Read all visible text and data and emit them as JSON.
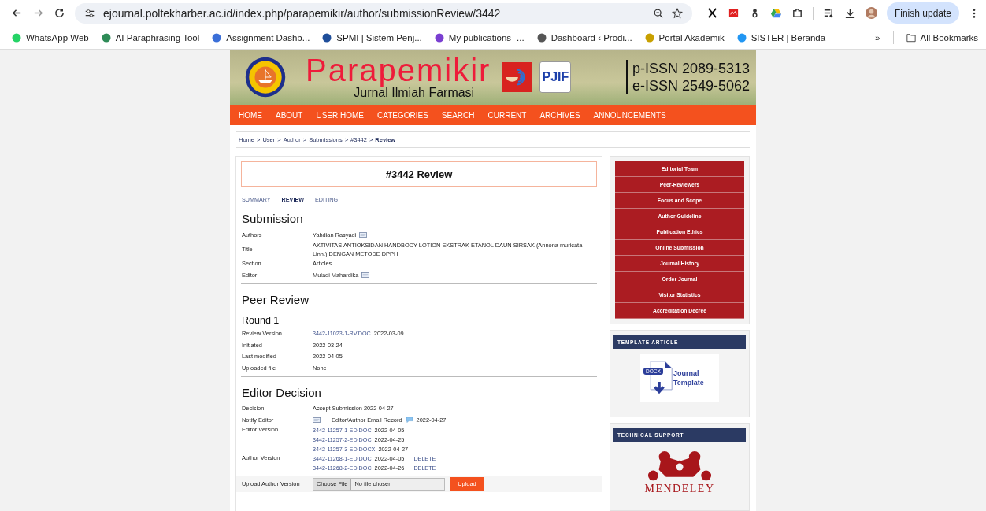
{
  "browser": {
    "address": "ejournal.poltekharber.ac.id/index.php/parapemikir/author/submissionReview/3442",
    "update_button": "Finish update",
    "bookmarks": [
      {
        "label": "WhatsApp Web"
      },
      {
        "label": "AI Paraphrasing Tool"
      },
      {
        "label": "Assignment Dashb..."
      },
      {
        "label": "SPMI | Sistem Penj..."
      },
      {
        "label": "My publications -..."
      },
      {
        "label": "Dashboard ‹ Prodi..."
      },
      {
        "label": "Portal Akademik"
      },
      {
        "label": "SISTER | Beranda"
      }
    ],
    "more": "»",
    "all_bookmarks": "All Bookmarks"
  },
  "header": {
    "title": "Parapemikir",
    "subtitle": "Jurnal Ilmiah Farmasi",
    "badge": "PJIF",
    "issn": [
      "p-ISSN 2089-5313",
      "e-ISSN 2549-5062"
    ]
  },
  "nav": [
    "HOME",
    "ABOUT",
    "USER HOME",
    "CATEGORIES",
    "SEARCH",
    "CURRENT",
    "ARCHIVES",
    "ANNOUNCEMENTS"
  ],
  "breadcrumb": {
    "links": [
      "Home",
      "User",
      "Author",
      "Submissions",
      "#3442"
    ],
    "current": "Review",
    "separator": ">"
  },
  "page_title": "#3442 Review",
  "tabs": [
    {
      "label": "SUMMARY",
      "selected": false
    },
    {
      "label": "REVIEW",
      "selected": true
    },
    {
      "label": "EDITING",
      "selected": false
    }
  ],
  "submission": {
    "heading": "Submission",
    "rows": [
      {
        "label": "Authors",
        "value": "Yahdian Rasyadi",
        "mail": true
      },
      {
        "label": "Title",
        "value": "AKTIVITAS ANTIOKSIDAN HANDBODY LOTION EKSTRAK ETANOL DAUN SIRSAK (Annona muricata Linn.) DENGAN METODE DPPH",
        "mail": false
      },
      {
        "label": "Section",
        "value": "Articles",
        "mail": false
      },
      {
        "label": "Editor",
        "value": "Muladi Mahardika",
        "mail": true
      }
    ]
  },
  "peer_review": {
    "heading": "Peer Review",
    "round": "Round 1",
    "rows": [
      {
        "label": "Review Version",
        "link": "3442-11023-1-RV.DOC",
        "value": "2022-03-09"
      },
      {
        "label": "Initiated",
        "value": "2022-03-24"
      },
      {
        "label": "Last modified",
        "value": "2022-04-05"
      },
      {
        "label": "Uploaded file",
        "value": "None"
      }
    ]
  },
  "editor_decision": {
    "heading": "Editor Decision",
    "rows": [
      {
        "kind": "text",
        "label": "Decision",
        "value": "Accept Submission 2022-04-27"
      },
      {
        "kind": "notify",
        "label": "Notify Editor",
        "value": "Editor/Author Email Record",
        "date": "2022-04-27"
      },
      {
        "kind": "files",
        "label": "Editor Version",
        "files": [
          {
            "name": "3442-11257-1-ED.DOC",
            "date": "2022-04-05"
          },
          {
            "name": "3442-11257-2-ED.DOC",
            "date": "2022-04-25"
          },
          {
            "name": "3442-11257-3-ED.DOCX",
            "date": "2022-04-27"
          }
        ]
      },
      {
        "kind": "files",
        "label": "Author Version",
        "files": [
          {
            "name": "3442-11268-1-ED.DOC",
            "date": "2022-04-05",
            "action": "DELETE"
          },
          {
            "name": "3442-11268-2-ED.DOC",
            "date": "2022-04-26",
            "action": "DELETE"
          }
        ]
      }
    ]
  },
  "upload": {
    "label": "Upload Author Version",
    "choose": "Choose File",
    "status": "No file chosen",
    "button": "Upload"
  },
  "sidebar": {
    "menu": [
      "Editorial Team",
      "Peer-Reviewers",
      "Focus and Scope",
      "Author Guideline",
      "Publication Ethics",
      "Online Submission",
      "Journal History",
      "Order Journal",
      "Visitor Statistics",
      "Accreditation Decree"
    ],
    "template": {
      "heading": "TEMPLATE ARTICLE",
      "doc_label": "DOCX",
      "text": "Journal Template"
    },
    "support": {
      "heading": "TECHNICAL SUPPORT",
      "logo_text": "MENDELEY"
    }
  }
}
